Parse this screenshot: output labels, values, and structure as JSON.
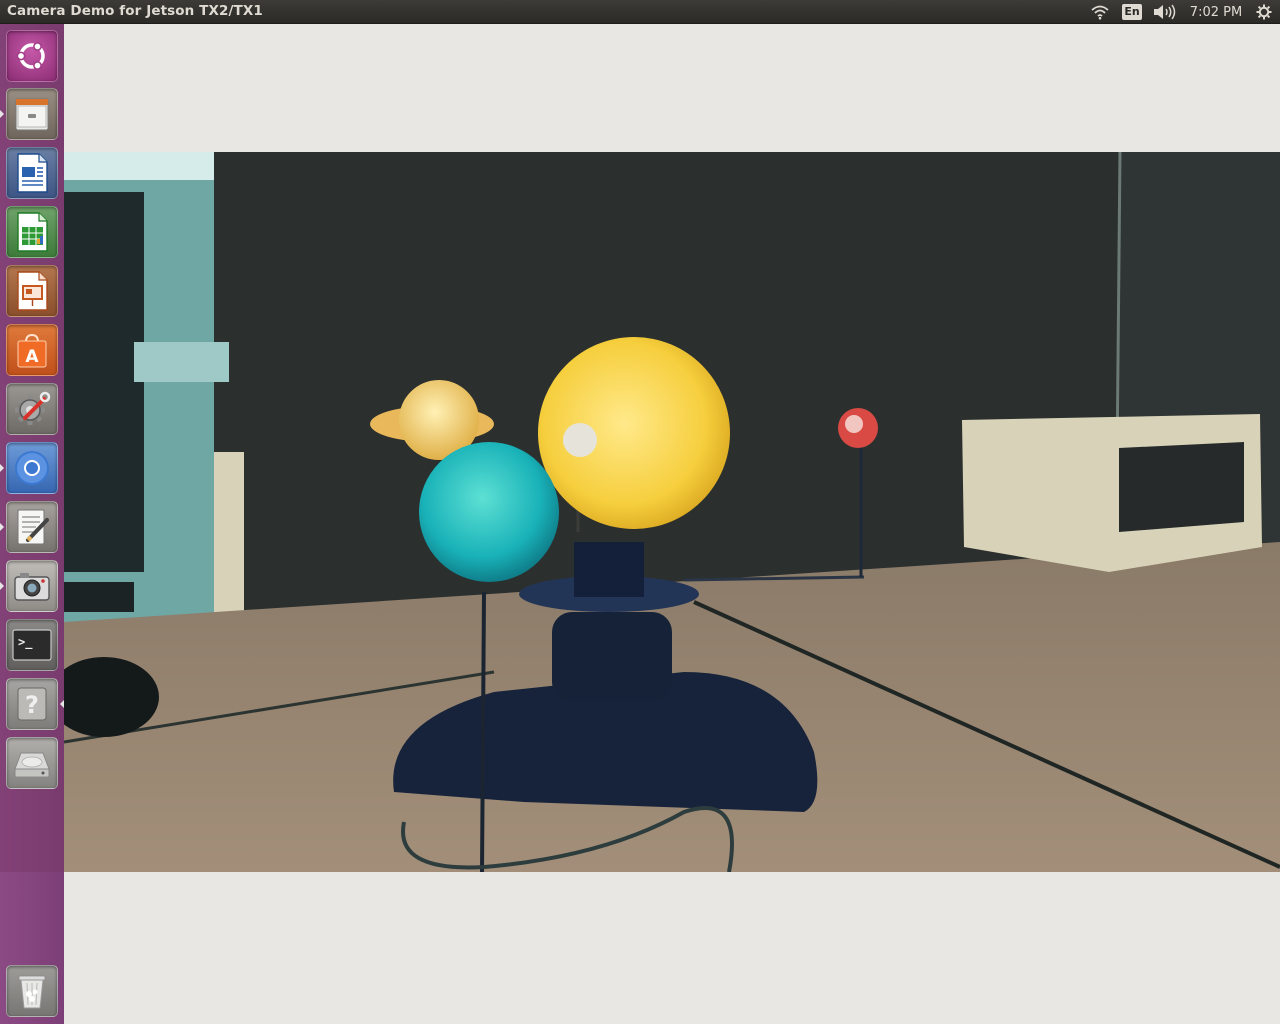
{
  "top_panel": {
    "window_title": "Camera Demo for Jetson TX2/TX1",
    "language": "En",
    "clock": "7:02 PM",
    "icons": [
      "wifi-icon",
      "keyboard-layout-indicator",
      "volume-icon",
      "settings-gear-icon"
    ]
  },
  "launcher": {
    "items": [
      {
        "name": "ubuntu-dash",
        "icon": "ubuntu-logo-icon"
      },
      {
        "name": "files",
        "icon": "file-cabinet-icon"
      },
      {
        "name": "libreoffice-writer",
        "icon": "writer-document-icon"
      },
      {
        "name": "libreoffice-calc",
        "icon": "calc-spreadsheet-icon"
      },
      {
        "name": "libreoffice-impress",
        "icon": "impress-presentation-icon"
      },
      {
        "name": "software-center",
        "icon": "shopping-bag-icon"
      },
      {
        "name": "system-settings",
        "icon": "gear-wrench-icon"
      },
      {
        "name": "chromium",
        "icon": "chromium-browser-icon"
      },
      {
        "name": "text-editor",
        "icon": "text-editor-icon"
      },
      {
        "name": "camera-app",
        "icon": "camera-icon"
      },
      {
        "name": "terminal",
        "icon": "terminal-icon"
      },
      {
        "name": "help",
        "icon": "help-question-icon"
      },
      {
        "name": "disk-drive",
        "icon": "hard-disk-icon"
      },
      {
        "name": "trash",
        "icon": "trash-icon"
      }
    ],
    "terminal_prompt": ">_",
    "help_glyph": "?"
  },
  "camera": {
    "feed": "live camera preview",
    "scene": "solar system orrery model on desk"
  },
  "colors": {
    "panel_bg": "#2c2b28",
    "launcher_bg": "#86457f",
    "window_bg": "#e8e7e3"
  }
}
